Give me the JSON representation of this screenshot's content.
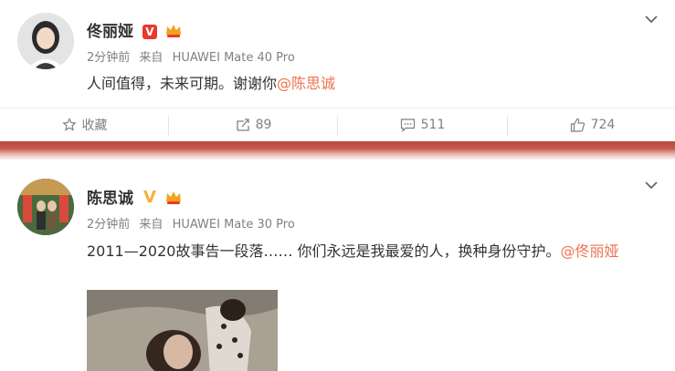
{
  "posts": [
    {
      "author": "佟丽娅",
      "time": "2分钟前",
      "source_prefix": "来自",
      "device": "HUAWEI Mate 40 Pro",
      "text": "人间值得，未来可期。谢谢你",
      "mention": "@陈思诚",
      "verified_color": "#e8392d",
      "actions": {
        "favorite_label": "收藏",
        "repost_count": "89",
        "comment_count": "511",
        "like_count": "724"
      }
    },
    {
      "author": "陈思诚",
      "time": "2分钟前",
      "source_prefix": "来自",
      "device": "HUAWEI Mate 30 Pro",
      "text": "2011—2020故事告一段落…… 你们永远是我最爱的人，换种身份守护。",
      "mention": "@佟丽娅",
      "verified_color": "#f4b23b"
    }
  ],
  "colors": {
    "mention": "#eb7350",
    "band": "#c8594d",
    "meta_text": "#808080"
  },
  "icons": [
    "chevron-down-icon",
    "star-icon",
    "repost-icon",
    "comment-icon",
    "like-icon",
    "verified-icon",
    "crown-badge-icon"
  ]
}
